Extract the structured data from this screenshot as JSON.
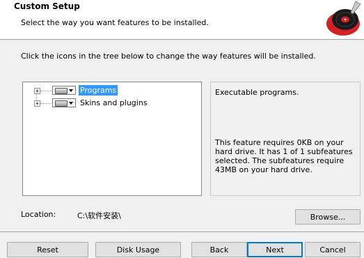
{
  "header": {
    "title": "Custom Setup",
    "subtitle": "Select the way you want features to be installed.",
    "logo_icon": "vinyl-record-logo-icon"
  },
  "instruction": "Click the icons in the tree below to change the way features will be installed.",
  "tree": {
    "items": [
      {
        "label": "Programs",
        "selected": true,
        "expander": "+",
        "icon": "hard-drive-icon"
      },
      {
        "label": "Skins and plugins",
        "selected": false,
        "expander": "+",
        "icon": "hard-drive-icon"
      }
    ]
  },
  "description": {
    "feature": "Executable programs.",
    "requirements": "This feature requires 0KB on your hard drive. It has 1 of 1 subfeatures selected. The subfeatures require 43MB on your hard drive."
  },
  "location": {
    "label": "Location:",
    "value": "C:\\软件安装\\"
  },
  "buttons": {
    "browse": "Browse...",
    "reset": "Reset",
    "disk_usage": "Disk Usage",
    "back": "Back",
    "next": "Next",
    "cancel": "Cancel"
  },
  "colors": {
    "selection": "#3399ff",
    "default_button_border": "#0078d7",
    "logo_red": "#d42027"
  }
}
